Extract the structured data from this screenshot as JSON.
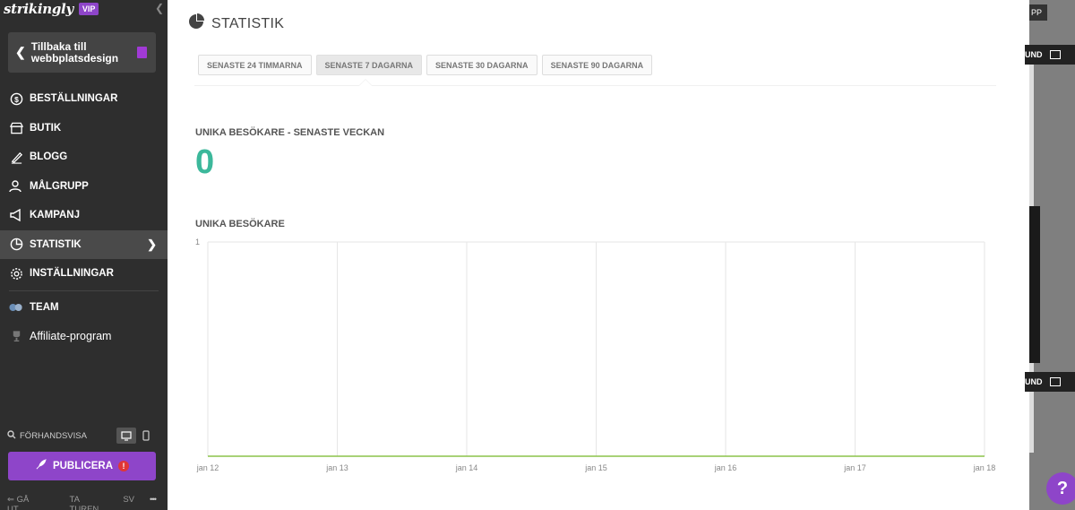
{
  "brand": {
    "logo": "strikingly",
    "badge": "VIP"
  },
  "sidebar": {
    "back_label": "Tillbaka till webbplatsdesign",
    "items": [
      {
        "label": "BESTÄLLNINGAR",
        "icon": "dollar-circle-icon"
      },
      {
        "label": "BUTIK",
        "icon": "store-icon"
      },
      {
        "label": "BLOGG",
        "icon": "pen-icon"
      },
      {
        "label": "MÅLGRUPP",
        "icon": "users-icon"
      },
      {
        "label": "KAMPANJ",
        "icon": "megaphone-icon"
      },
      {
        "label": "STATISTIK",
        "icon": "pie-chart-icon",
        "active": true
      },
      {
        "label": "INSTÄLLNINGAR",
        "icon": "gear-icon"
      },
      {
        "label": "TEAM",
        "icon": "team-icon"
      },
      {
        "label": "Affiliate-program",
        "icon": "trophy-icon"
      }
    ],
    "preview_label": "FÖRHANDSVISA",
    "publish_label": "PUBLICERA",
    "footer": {
      "logout": "GÅ UT",
      "tour": "TA TUREN",
      "lang": "SV",
      "more": "•••"
    }
  },
  "main": {
    "title": "STATISTIK",
    "tabs": [
      {
        "label": "SENASTE 24 TIMMARNA"
      },
      {
        "label": "SENASTE 7 DAGARNA",
        "active": true
      },
      {
        "label": "SENASTE 30 DAGARNA"
      },
      {
        "label": "SENASTE 90 DAGARNA"
      }
    ],
    "unique_week_label": "UNIKA BESÖKARE - SENASTE VECKAN",
    "unique_week_count": "0",
    "unique_chart_label": "UNIKA BESÖKARE"
  },
  "chart_data": {
    "type": "line",
    "categories": [
      "jan 12",
      "jan 13",
      "jan 14",
      "jan 15",
      "jan 16",
      "jan 17",
      "jan 18"
    ],
    "series": [
      {
        "values": [
          0,
          0,
          0,
          0,
          0,
          0,
          0
        ],
        "color": "#8bc34a"
      }
    ],
    "ylim": [
      0,
      1
    ],
    "ytick": "1",
    "grid": true
  },
  "right": {
    "app_tag": "PP",
    "bg_label": "UND"
  },
  "help": "?"
}
